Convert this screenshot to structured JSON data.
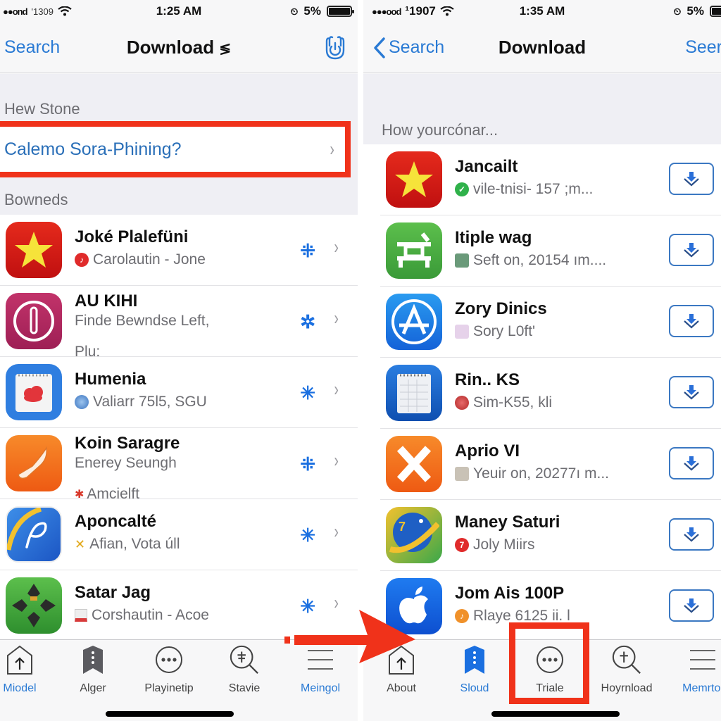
{
  "colors": {
    "accent_blue": "#2a7ad4",
    "highlight_red": "#f0321a",
    "action_blue": "#1a6fe0",
    "secondary_text": "#6d6d72"
  },
  "left_screen": {
    "status_bar": {
      "signal": "●●ond",
      "carrier": "'1309",
      "time": "1:25 AM",
      "battery_percent": "5%"
    },
    "nav": {
      "back_label": "Search",
      "title": "Download",
      "right_icon": "power-hand-icon"
    },
    "section_1_header": "Hew Stone",
    "highlighted_row": {
      "label": "Calemo Sora-Phining?"
    },
    "section_2_header": "Bowneds",
    "apps": [
      {
        "title": "Joké Plalefüni",
        "subtitle": "Carolautin - Jone",
        "subtitle_2": "",
        "icon": "star-app-icon",
        "badge_icon": "music-badge-icon",
        "action_icon": "asterisk-icon"
      },
      {
        "title": "AU KIHI",
        "subtitle": "Finde Bewndse Left,",
        "subtitle_2": "Plu:",
        "icon": "power-app-icon",
        "badge_icon": "",
        "action_icon": "asterisk-icon"
      },
      {
        "title": "Humenia",
        "subtitle": "Valiarr 75l5, SGU",
        "subtitle_2": "",
        "icon": "calendar-app-icon",
        "badge_icon": "globe-badge-icon",
        "action_icon": "asterisk-icon"
      },
      {
        "title": "Koin Saragre",
        "subtitle": "Enerey Seungh",
        "subtitle_2": "Amcielft",
        "icon": "feather-app-icon",
        "badge_icon": "bug-badge-icon",
        "action_icon": "asterisk-icon"
      },
      {
        "title": "Aponcalté",
        "subtitle": "Afian, Vota úll",
        "subtitle_2": "",
        "icon": "pen-app-icon",
        "badge_icon": "tools-badge-icon",
        "action_icon": "asterisk-icon"
      },
      {
        "title": "Satar Jag",
        "subtitle": "Corshautin - Acoe",
        "subtitle_2": "",
        "icon": "dpad-app-icon",
        "badge_icon": "card-badge-icon",
        "action_icon": "asterisk-icon"
      }
    ],
    "tabs": [
      {
        "label": "Miodel",
        "icon": "home-upload-icon",
        "active": true
      },
      {
        "label": "Alger",
        "icon": "bookmark-icon",
        "active": false
      },
      {
        "label": "Playinetip",
        "icon": "more-circle-icon",
        "active": false
      },
      {
        "label": "Stavie",
        "icon": "search-plus-icon",
        "active": false
      },
      {
        "label": "Meingol",
        "icon": "menu-icon",
        "active": true
      }
    ]
  },
  "right_screen": {
    "status_bar": {
      "signal": "●●●ood",
      "carrier": "¹1907",
      "time": "1:35 AM",
      "battery_percent": "5%"
    },
    "nav": {
      "back_label": "Search",
      "title": "Download",
      "right_label": "Seer"
    },
    "section_header": "How yourcónar...",
    "apps": [
      {
        "title": "Jancailt",
        "subtitle": "vile-tnisi- 157 ;m...",
        "icon": "star-app-icon",
        "badge_icon": "check-badge-icon"
      },
      {
        "title": "Itiple wag",
        "subtitle": "Seft on, 20154 ım....",
        "icon": "grid-app-icon",
        "badge_icon": "avatar-badge-icon"
      },
      {
        "title": "Zory Dinics",
        "subtitle": "Sory L0ft'",
        "icon": "appstore-app-icon",
        "badge_icon": "image-badge-icon"
      },
      {
        "title": "Rin.. KS",
        "subtitle": "Sim-K55, kli",
        "icon": "notepad-app-icon",
        "badge_icon": "globe-badge-icon"
      },
      {
        "title": "Aprio VI",
        "subtitle": "Yeuir on, 20277ı m...",
        "icon": "x-app-icon",
        "badge_icon": "image-badge-icon"
      },
      {
        "title": "Maney Saturi",
        "subtitle": "Joly Miirs",
        "icon": "globe-app-icon",
        "badge_icon": "seven-badge-icon"
      },
      {
        "title": "Jom Ais 100P",
        "subtitle": "Rlaye 6125 ii. l",
        "icon": "apple-app-icon",
        "badge_icon": "music-badge-icon"
      }
    ],
    "download_button_icon": "download-arrow-icon",
    "tabs": [
      {
        "label": "About",
        "icon": "home-upload-icon",
        "active": false
      },
      {
        "label": "Sloud",
        "icon": "bookmark-icon",
        "active": true
      },
      {
        "label": "Triale",
        "icon": "more-circle-icon",
        "active": false
      },
      {
        "label": "Hoyrnload",
        "icon": "search-plus-icon",
        "active": false
      },
      {
        "label": "Memrtol",
        "icon": "menu-icon",
        "active": true
      }
    ]
  },
  "annotations": {
    "arrow_icon": "red-arrow-icon",
    "boxes": [
      "highlighted-row-box",
      "triale-tab-box"
    ]
  },
  "badge_glyphs": {
    "music": "♪",
    "seven": "7",
    "check": "✓"
  }
}
